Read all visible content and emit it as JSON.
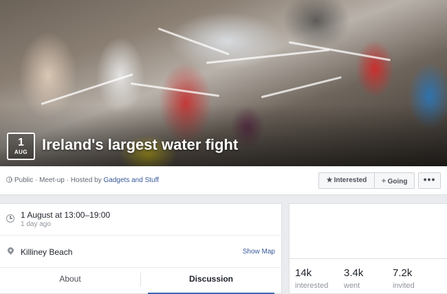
{
  "event": {
    "title": "Ireland's largest water fight",
    "date_badge": {
      "day": "1",
      "month": "AUG"
    }
  },
  "header": {
    "privacy": "Public",
    "sep1": " · ",
    "type": "Meet-up",
    "sep2": " · ",
    "hosted_by_prefix": "Hosted by ",
    "host": "Gadgets and Stuff",
    "buttons": {
      "interested_icon": "★",
      "interested": "Interested",
      "going_icon": "+",
      "going": "Going",
      "more": "•••"
    }
  },
  "details": {
    "time_main": "1 August at 13:00–19:00",
    "time_sub": "1 day ago",
    "location": "Killiney Beach",
    "show_map": "Show Map"
  },
  "tabs": [
    {
      "label": "About"
    },
    {
      "label": "Discussion",
      "active": true
    }
  ],
  "stats": [
    {
      "value": "14k",
      "label": "interested"
    },
    {
      "value": "3.4k",
      "label": "went"
    },
    {
      "value": "7.2k",
      "label": "invited"
    }
  ],
  "colors": {
    "link": "#365899",
    "active_tab_underline": "#4267b2",
    "page_background": "#e9ebee"
  },
  "icons": [
    "globe-icon",
    "clock-icon",
    "location-pin-icon",
    "star-icon",
    "plus-icon",
    "more-icon"
  ]
}
